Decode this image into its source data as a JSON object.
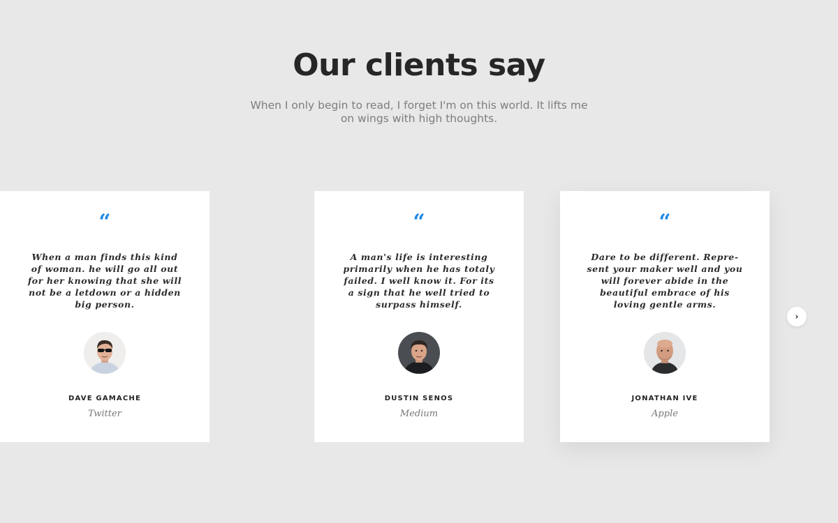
{
  "header": {
    "title": "Our clients say",
    "subtitle": "When I only begin to read, I forget I'm on this world. It lifts me on wings with high thoughts."
  },
  "nav": {
    "prev_icon": "chevron-left-icon",
    "next_icon": "chevron-right-icon",
    "prev_glyph": "‹",
    "next_glyph": "›"
  },
  "testimonials": [
    {
      "quote_mark": "“",
      "quote": "A man's life is interesting primarily when he has totaly failed. I well know it. For its a sign that he well tried to surpass himself.",
      "name": "DUSTIN SENOS",
      "company": "Medium"
    },
    {
      "quote_mark": "“",
      "quote": "Dare to be different. Repre-sent your maker well and you will forever abide in the beautiful embrace of his loving gentle arms.",
      "name": "JONATHAN IVE",
      "company": "Apple"
    },
    {
      "quote_mark": "“",
      "quote": "When a man finds this kind of woman. he will go all out for her knowing that she will not be a letdown or a hidden big person.",
      "name": "DAVE GAMACHE",
      "company": "Twitter"
    }
  ],
  "colors": {
    "background": "#e8e8e8",
    "card": "#ffffff",
    "accent": "#1e88e5",
    "heading": "#262626"
  }
}
